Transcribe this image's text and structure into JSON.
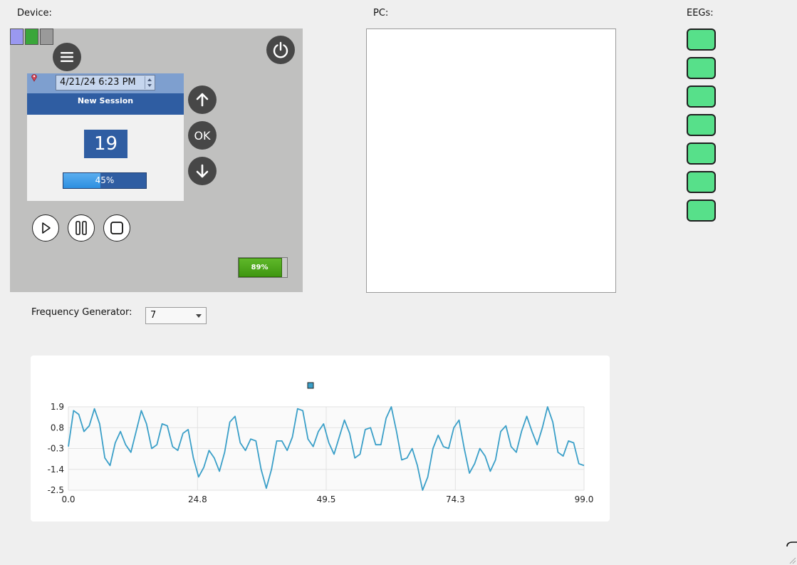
{
  "labels": {
    "device": "Device:",
    "pc": "PC:",
    "eegs": "EEGs:",
    "frequency_generator": "Frequency Generator:"
  },
  "device": {
    "swatches": [
      {
        "name": "purple",
        "color": "#9a98f0"
      },
      {
        "name": "green",
        "color": "#3aa63a"
      },
      {
        "name": "gray",
        "color": "#9a9a9a"
      }
    ],
    "datetime": "4/21/24 6:23 PM",
    "session_title": "New Session",
    "counter": "19",
    "progress_label": "45%",
    "progress": 0.45,
    "ok_label": "OK",
    "battery_label": "89%",
    "battery": 0.89
  },
  "eegs": {
    "count": 7,
    "color": "#57e08a"
  },
  "frequency_generator": {
    "value": "7"
  },
  "chart_data": {
    "type": "line",
    "title": "",
    "xlabel": "",
    "ylabel": "",
    "xlim": [
      0.0,
      99.0
    ],
    "ylim": [
      -2.5,
      1.9
    ],
    "x_ticks": [
      "0.0",
      "24.8",
      "49.5",
      "74.3",
      "99.0"
    ],
    "y_ticks": [
      "1.9",
      "0.8",
      "-0.3",
      "-1.4",
      "-2.5"
    ],
    "legend": "top-center",
    "series": [
      {
        "color": "#3a9fc8",
        "x": [
          0,
          1,
          2,
          3,
          4,
          5,
          6,
          7,
          8,
          9,
          10,
          11,
          12,
          13,
          14,
          15,
          16,
          17,
          18,
          19,
          20,
          21,
          22,
          23,
          24,
          25,
          26,
          27,
          28,
          29,
          30,
          31,
          32,
          33,
          34,
          35,
          36,
          37,
          38,
          39,
          40,
          41,
          42,
          43,
          44,
          45,
          46,
          47,
          48,
          49,
          50,
          51,
          52,
          53,
          54,
          55,
          56,
          57,
          58,
          59,
          60,
          61,
          62,
          63,
          64,
          65,
          66,
          67,
          68,
          69,
          70,
          71,
          72,
          73,
          74,
          75,
          76,
          77,
          78,
          79,
          80,
          81,
          82,
          83,
          84,
          85,
          86,
          87,
          88,
          89,
          90,
          91,
          92,
          93,
          94,
          95,
          96,
          97,
          98,
          99
        ],
        "y": [
          -0.2,
          1.7,
          1.5,
          0.6,
          0.9,
          1.8,
          1.0,
          -0.8,
          -1.2,
          0.0,
          0.6,
          -0.1,
          -0.5,
          0.6,
          1.7,
          1.0,
          -0.3,
          -0.1,
          1.0,
          0.9,
          -0.2,
          -0.4,
          0.5,
          0.7,
          -0.8,
          -1.8,
          -1.3,
          -0.4,
          -0.8,
          -1.5,
          -0.5,
          1.1,
          1.4,
          0.0,
          -0.4,
          0.2,
          0.1,
          -1.4,
          -2.4,
          -1.4,
          0.1,
          0.1,
          -0.4,
          0.3,
          1.8,
          1.7,
          0.2,
          -0.2,
          0.6,
          1.0,
          0.0,
          -0.6,
          0.3,
          1.2,
          0.5,
          -0.8,
          -0.6,
          0.7,
          0.8,
          -0.1,
          -0.1,
          1.3,
          1.9,
          0.6,
          -0.9,
          -0.8,
          -0.3,
          -1.2,
          -2.5,
          -1.8,
          -0.3,
          0.4,
          -0.2,
          -0.3,
          0.8,
          1.2,
          -0.3,
          -1.6,
          -1.1,
          -0.3,
          -0.7,
          -1.5,
          -0.9,
          0.6,
          0.9,
          -0.2,
          -0.5,
          0.6,
          1.4,
          0.6,
          -0.1,
          0.8,
          1.9,
          1.1,
          -0.5,
          -0.7,
          0.1,
          0.0,
          -1.1,
          -1.2
        ]
      }
    ]
  }
}
